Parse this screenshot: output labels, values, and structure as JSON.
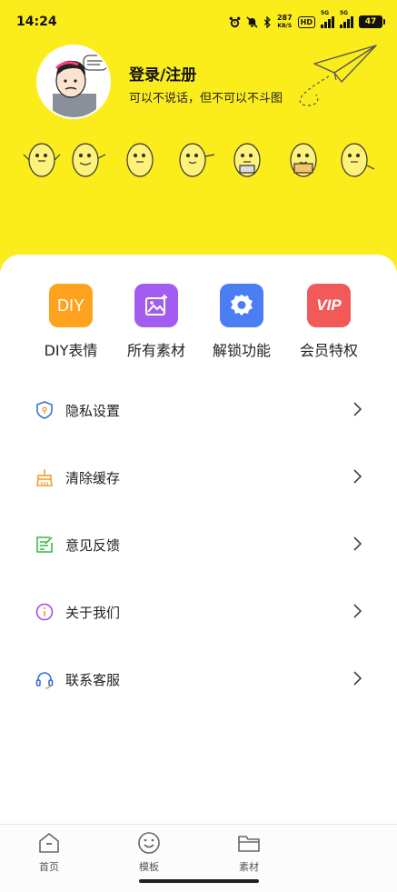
{
  "status_bar": {
    "time": "14:24",
    "net_speed_value": "287",
    "net_speed_unit": "KB/S",
    "hd_label": "HD",
    "signal_tag_1": "5G",
    "signal_tag_2": "5G",
    "battery": "47"
  },
  "profile": {
    "login_label": "登录/注册",
    "slogan": "可以不说话，但不可以不斗图"
  },
  "quick_actions": [
    {
      "label": "DIY表情",
      "icon_text": "DIY",
      "icon": "diy-icon",
      "color": "#ffa21e"
    },
    {
      "label": "所有素材",
      "icon": "image-sparkle-icon",
      "color": "#a35cf0"
    },
    {
      "label": "解锁功能",
      "icon": "gear-icon",
      "color": "#4a7ef2"
    },
    {
      "label": "会员特权",
      "icon_text": "VIP",
      "icon": "vip-icon",
      "color": "#f25a5a"
    }
  ],
  "menu": [
    {
      "label": "隐私设置",
      "icon": "shield-icon",
      "color": "#3a6fd8"
    },
    {
      "label": "清除缓存",
      "icon": "broom-icon",
      "color": "#f0a030"
    },
    {
      "label": "意见反馈",
      "icon": "feedback-note-icon",
      "color": "#3cb94a"
    },
    {
      "label": "关于我们",
      "icon": "info-icon",
      "color": "#b048d8"
    },
    {
      "label": "联系客服",
      "icon": "headset-icon",
      "color": "#3a6fd8"
    }
  ],
  "tabbar": [
    {
      "label": "首页",
      "icon": "home-icon"
    },
    {
      "label": "模板",
      "icon": "smiley-icon"
    },
    {
      "label": "素材",
      "icon": "folder-icon"
    }
  ],
  "colors": {
    "header_bg": "#fbed1c",
    "card_bg": "#ffffff"
  }
}
